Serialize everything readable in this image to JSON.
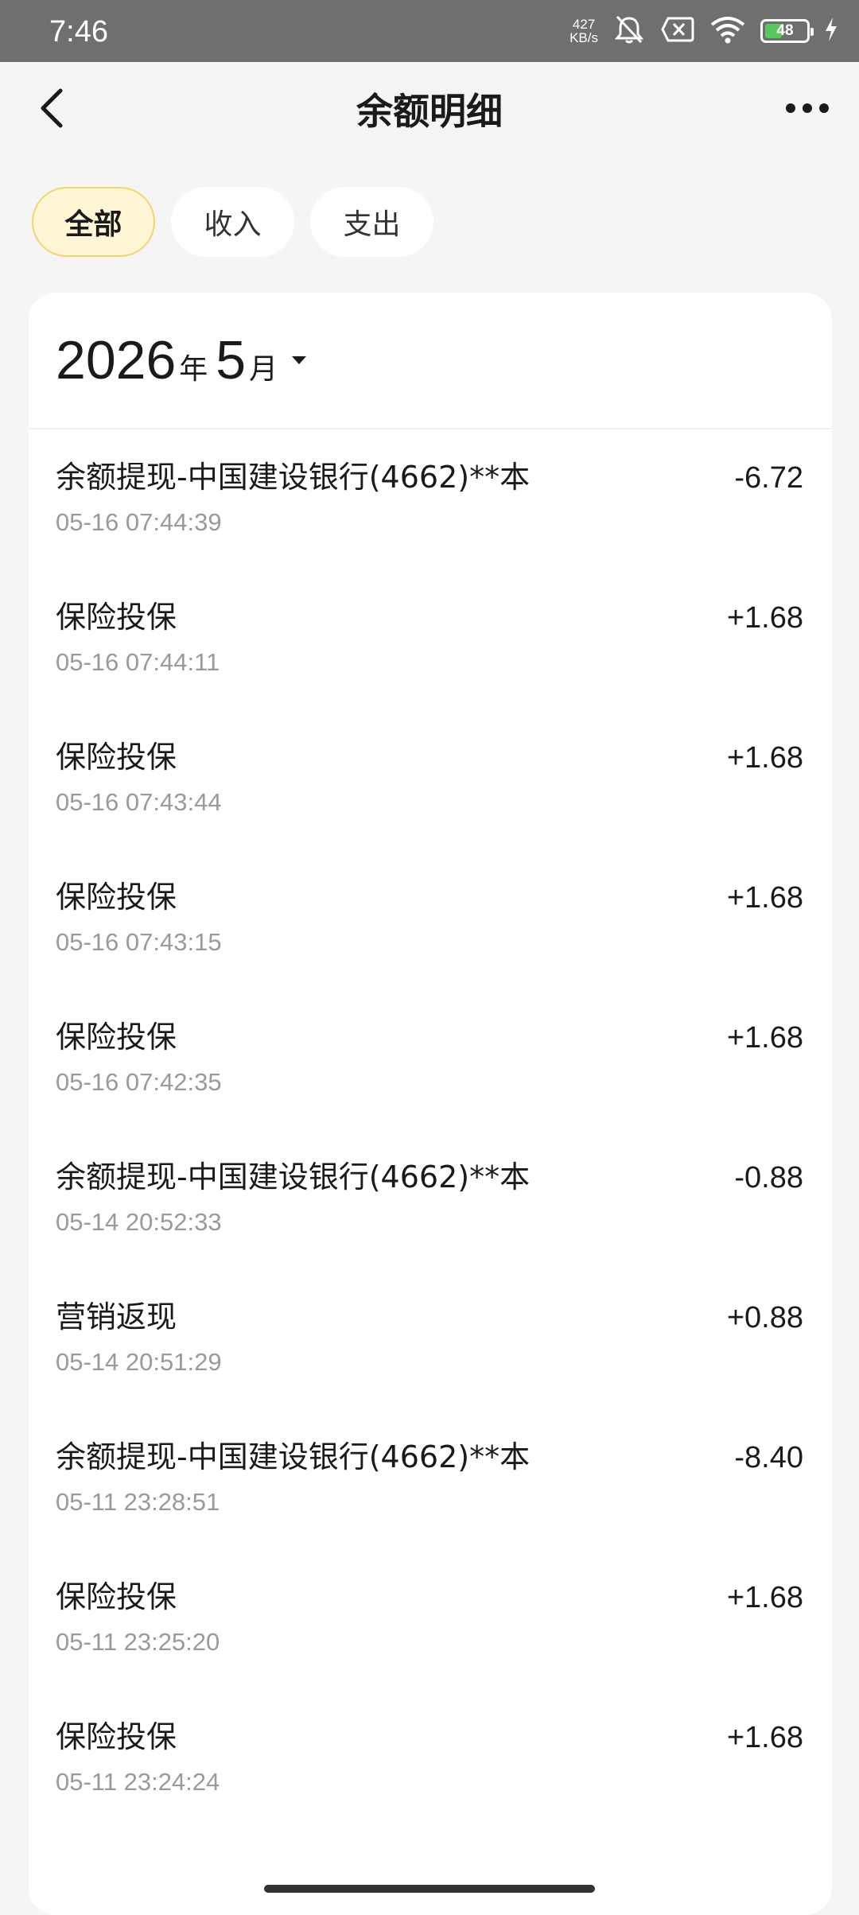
{
  "status_bar": {
    "time": "7:46",
    "net_speed_value": "427",
    "net_speed_unit": "KB/s",
    "battery_level": "48",
    "battery_percent": 48,
    "icons": [
      "mute-icon",
      "sim-disabled-icon",
      "wifi-icon",
      "battery-icon",
      "charging-icon"
    ]
  },
  "header": {
    "title": "余额明细",
    "back_icon": "chevron-left-icon",
    "more_icon": "more-icon"
  },
  "tabs": [
    {
      "label": "全部",
      "active": true
    },
    {
      "label": "收入",
      "active": false
    },
    {
      "label": "支出",
      "active": false
    }
  ],
  "month": {
    "year": "2026",
    "year_unit": "年",
    "month": "5",
    "month_unit": "月",
    "caret_icon": "caret-down-icon"
  },
  "transactions": [
    {
      "title": "余额提现-中国建设银行(4662)**本",
      "time": "05-16 07:44:39",
      "amount": "-6.72"
    },
    {
      "title": "保险投保",
      "time": "05-16 07:44:11",
      "amount": "+1.68"
    },
    {
      "title": "保险投保",
      "time": "05-16 07:43:44",
      "amount": "+1.68"
    },
    {
      "title": "保险投保",
      "time": "05-16 07:43:15",
      "amount": "+1.68"
    },
    {
      "title": "保险投保",
      "time": "05-16 07:42:35",
      "amount": "+1.68"
    },
    {
      "title": "余额提现-中国建设银行(4662)**本",
      "time": "05-14 20:52:33",
      "amount": "-0.88"
    },
    {
      "title": "营销返现",
      "time": "05-14 20:51:29",
      "amount": "+0.88"
    },
    {
      "title": "余额提现-中国建设银行(4662)**本",
      "time": "05-11 23:28:51",
      "amount": "-8.40"
    },
    {
      "title": "保险投保",
      "time": "05-11 23:25:20",
      "amount": "+1.68"
    },
    {
      "title": "保险投保",
      "time": "05-11 23:24:24",
      "amount": "+1.68"
    }
  ],
  "colors": {
    "accent_tab_bg": "#fff6d6",
    "accent_tab_border": "#f3d56b",
    "page_bg": "#f5f5f5",
    "status_bar_bg": "#6f6f6f",
    "battery_green": "#58c85c"
  }
}
